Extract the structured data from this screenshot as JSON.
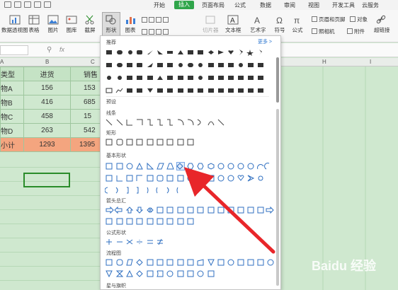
{
  "menu": {
    "items": [
      "开始",
      "插入",
      "页面布局",
      "公式",
      "数据",
      "审阅",
      "视图",
      "开发工具",
      "云服务"
    ],
    "active_index": 1
  },
  "ribbon": {
    "pivot": "数据透视图",
    "table": "表格",
    "picture": "图片",
    "gallery": "图库",
    "screenshot": "截屏",
    "shapes": "形状",
    "chart": "图表",
    "online_chart": "在线图表",
    "slicer": "切片器",
    "textbox": "文本框",
    "wordart": "艺术字",
    "symbol": "符号",
    "formula": "公式",
    "header_footer": "页眉和页脚",
    "object": "对象",
    "camera": "照相机",
    "attach": "附件",
    "hyperlink": "超链接"
  },
  "formula_bar": {
    "fx": "fx",
    "zoom_icon": "magnifier-icon"
  },
  "columns": [
    "A",
    "B",
    "C",
    "H",
    "I"
  ],
  "sheet": {
    "header": [
      "类型",
      "进货",
      "销售"
    ],
    "rows": [
      [
        "物A",
        "156",
        "153"
      ],
      [
        "物B",
        "416",
        "685"
      ],
      [
        "物C",
        "458",
        "15"
      ],
      [
        "物D",
        "263",
        "542"
      ]
    ],
    "total": [
      "小计",
      "1293",
      "1395"
    ]
  },
  "panel": {
    "recommended": "推荐",
    "more": "更多 >",
    "preset": "预设",
    "lines": "线条",
    "rect": "矩形",
    "basic": "基本形状",
    "arrows": "箭头总汇",
    "formula_shapes": "公式形状",
    "flowchart": "流程图",
    "stars": "星与旗帜"
  },
  "watermark": "Baidu 经验",
  "colors": {
    "accent": "#2fa54a",
    "sheet_bg": "#cfe8cf",
    "total_row": "#f4a57f",
    "arrow": "#e8262a"
  }
}
